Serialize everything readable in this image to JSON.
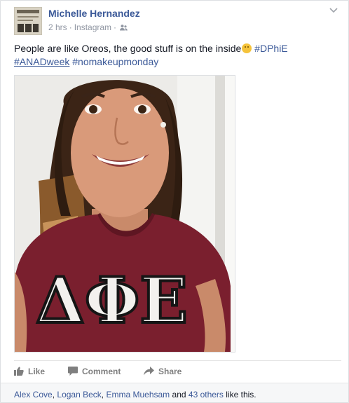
{
  "post": {
    "author": "Michelle Hernandez",
    "time": "2 hrs",
    "source": "Instagram",
    "separator": "·",
    "text": "People are like Oreos, the good stuff is on the inside",
    "hashtags": [
      "#DPhiE",
      "#ANADweek",
      "#nomakeupmonday"
    ]
  },
  "photo": {
    "shirt_letters": "ΔΦΕ"
  },
  "actions": {
    "like_label": "Like",
    "comment_label": "Comment",
    "share_label": "Share"
  },
  "likes": {
    "names": [
      "Alex Cove",
      "Logan Beck",
      "Emma Muehsam"
    ],
    "comma": ",",
    "and": "and",
    "others": "43 others",
    "suffix": "like this."
  },
  "colors": {
    "link": "#3b5998",
    "muted": "#9197a3",
    "shirt": "#7a1f2e"
  },
  "icons": {
    "audience": "friends-icon",
    "menu": "chevron-down-icon",
    "emoji": "smiling-face-icon",
    "like": "thumbs-up-icon",
    "comment": "speech-bubble-icon",
    "share": "share-arrow-icon"
  }
}
